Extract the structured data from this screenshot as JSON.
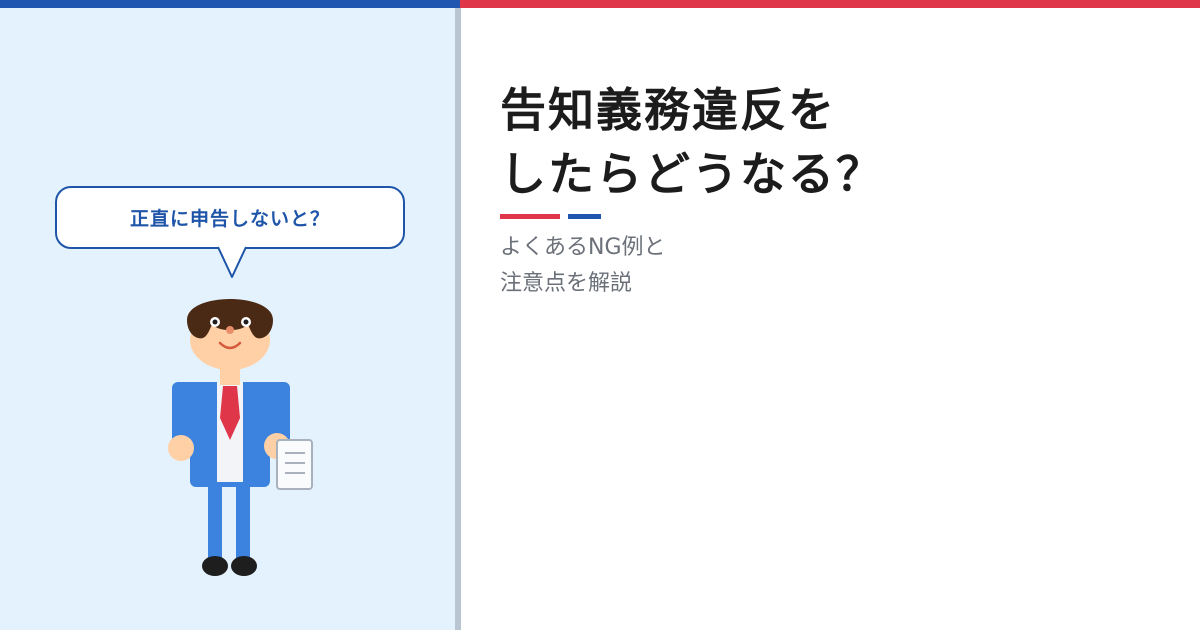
{
  "title": {
    "line1": "告知義務違反を",
    "line2": "したらどうなる？"
  },
  "subtitle": {
    "line1": "よくあるNG例と",
    "line2": "注意点を解説"
  },
  "speech_bubble": {
    "text": "正直に申告しないと？"
  },
  "colors": {
    "accent_blue": "#2156b0",
    "accent_red": "#e0364a",
    "panel_background": "#e3f2fd",
    "title_text": "#1c1c1c",
    "subtitle_text": "#6b7079"
  },
  "icons": {
    "character": "businessman-holding-document-icon",
    "document": "document-icon"
  }
}
